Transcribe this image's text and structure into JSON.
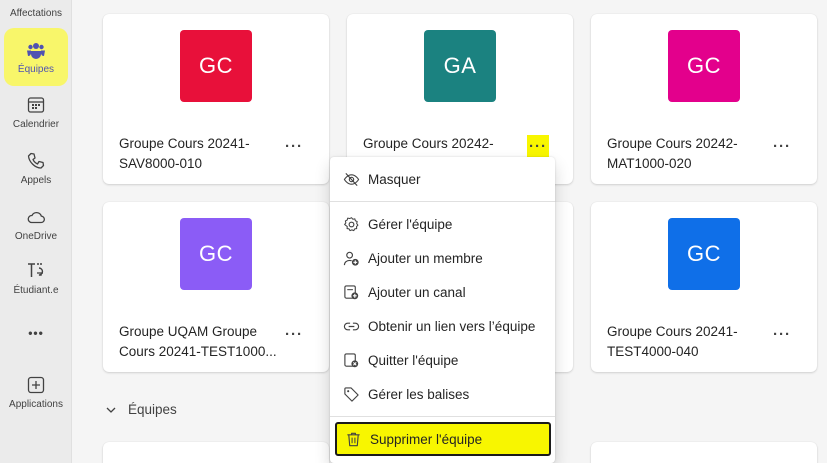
{
  "rail": {
    "items": [
      {
        "label": "Affectations"
      },
      {
        "label": "Équipes"
      },
      {
        "label": "Calendrier"
      },
      {
        "label": "Appels"
      },
      {
        "label": "OneDrive"
      },
      {
        "label": "Étudiant.e"
      },
      {
        "label": "•••"
      },
      {
        "label": "Applications"
      }
    ]
  },
  "cards": [
    {
      "initials": "GC",
      "name": "Groupe Cours 20241-SAV8000-010",
      "color": "#e8103a"
    },
    {
      "initials": "GA",
      "name": "Groupe Cours 20242-",
      "color": "#1b8280"
    },
    {
      "initials": "GC",
      "name": "Groupe Cours 20242-MAT1000-020",
      "color": "#e3008c"
    },
    {
      "initials": "GC",
      "name": "Groupe UQAM Groupe Cours 20241-TEST1000...",
      "color": "#8b5cf6"
    },
    {
      "initials": "GC",
      "name": "Groupe Cours 20241-TEST4000-040",
      "color": "#0f6fe8"
    }
  ],
  "more_label": "···",
  "section": {
    "label": "Équipes"
  },
  "menu": {
    "items": [
      {
        "label": "Masquer",
        "icon": "eye-off-icon"
      },
      {
        "label": "Gérer l'équipe",
        "icon": "gear-icon"
      },
      {
        "label": "Ajouter un membre",
        "icon": "person-add-icon"
      },
      {
        "label": "Ajouter un canal",
        "icon": "channel-add-icon"
      },
      {
        "label": "Obtenir un lien vers l’équipe",
        "icon": "link-icon"
      },
      {
        "label": "Quitter l'équipe",
        "icon": "leave-icon"
      },
      {
        "label": "Gérer les balises",
        "icon": "tag-icon"
      },
      {
        "label": "Supprimer l'équipe",
        "icon": "trash-icon"
      }
    ]
  },
  "colors": {
    "highlight": "#f8f600",
    "accent": "#4f52b2"
  }
}
